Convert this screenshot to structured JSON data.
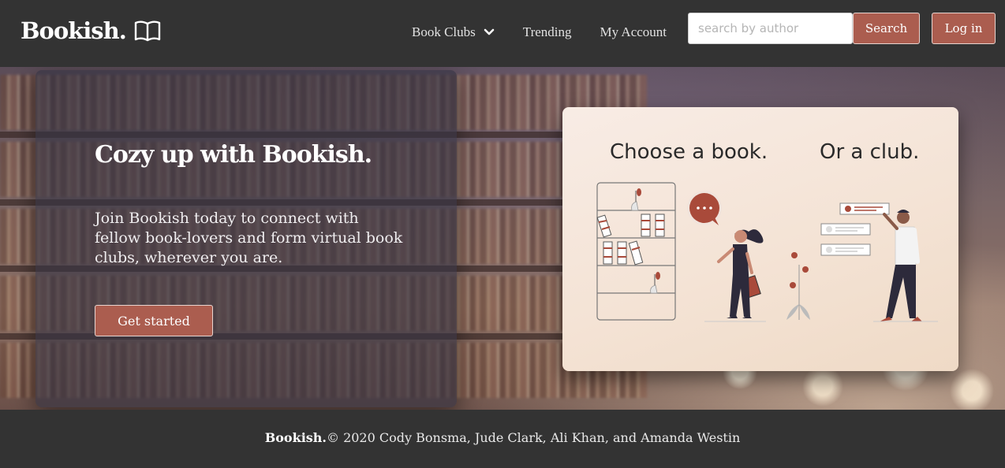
{
  "navbar": {
    "brand": "Bookish.",
    "brand_icon": "open-book-icon",
    "links": [
      "Book Clubs",
      "Trending",
      "My Account"
    ],
    "dropdown_icon": "chevron-down-icon",
    "search_placeholder": "search by author",
    "search_value": "",
    "search_label": "Search",
    "login_label": "Log in"
  },
  "hero": {
    "heading": "Cozy up with Bookish.",
    "text": "Join Bookish today to connect with fellow book-lovers and form virtual book clubs, wherever you are.",
    "cta_label": "Get started"
  },
  "illustration": {
    "left_title": "Choose a book.",
    "right_title": "Or a club."
  },
  "footer": {
    "brand": "Bookish.",
    "copyright": "© 2020 Cody Bonsma, Jude Clark, Ali Khan, and Amanda Westin"
  },
  "colors": {
    "navbar_bg": "#333333",
    "accent": "#ab5d4f",
    "card_bg": "#f4e3d5"
  }
}
